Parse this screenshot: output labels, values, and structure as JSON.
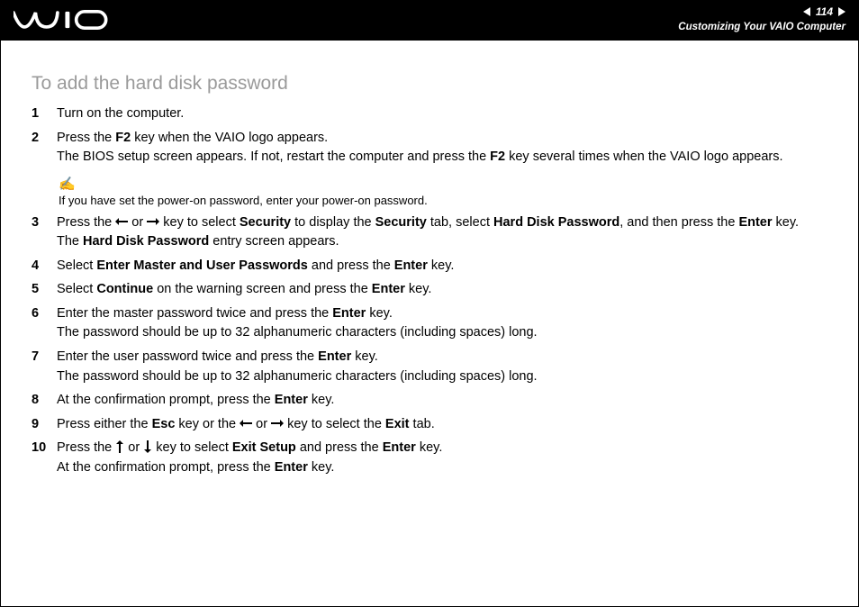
{
  "header": {
    "page_number": "114",
    "section_title": "Customizing Your VAIO Computer"
  },
  "heading": "To add the hard disk password",
  "note": "If you have set the power-on password, enter your power-on password.",
  "steps": {
    "s1": {
      "num": "1",
      "t1": "Turn on the computer."
    },
    "s2": {
      "num": "2",
      "p1a": "Press the ",
      "p1b": "F2",
      "p1c": " key when the VAIO logo appears.",
      "p2a": "The BIOS setup screen appears. If not, restart the computer and press the ",
      "p2b": "F2",
      "p2c": " key several times when the VAIO logo appears."
    },
    "s3": {
      "num": "3",
      "p1a": "Press the ",
      "p1b": " or ",
      "p1c": " key to select ",
      "p1d": "Security",
      "p1e": " to display the ",
      "p1f": "Security",
      "p1g": " tab, select ",
      "p1h": "Hard Disk Password",
      "p1i": ", and then press the ",
      "p1j": "Enter",
      "p1k": " key.",
      "p2a": "The ",
      "p2b": "Hard Disk Password",
      "p2c": " entry screen appears."
    },
    "s4": {
      "num": "4",
      "p1a": "Select ",
      "p1b": "Enter Master and User Passwords",
      "p1c": " and press the ",
      "p1d": "Enter",
      "p1e": " key."
    },
    "s5": {
      "num": "5",
      "p1a": "Select ",
      "p1b": "Continue",
      "p1c": " on the warning screen and press the ",
      "p1d": "Enter",
      "p1e": " key."
    },
    "s6": {
      "num": "6",
      "p1a": "Enter the master password twice and press the ",
      "p1b": "Enter",
      "p1c": " key.",
      "p2": "The password should be up to 32 alphanumeric characters (including spaces) long."
    },
    "s7": {
      "num": "7",
      "p1a": "Enter the user password twice and press the ",
      "p1b": "Enter",
      "p1c": " key.",
      "p2": "The password should be up to 32 alphanumeric characters (including spaces) long."
    },
    "s8": {
      "num": "8",
      "p1a": "At the confirmation prompt, press the ",
      "p1b": "Enter",
      "p1c": " key."
    },
    "s9": {
      "num": "9",
      "p1a": "Press either the ",
      "p1b": "Esc",
      "p1c": " key or the ",
      "p1d": " or ",
      "p1e": " key to select the ",
      "p1f": "Exit",
      "p1g": " tab."
    },
    "s10": {
      "num": "10",
      "p1a": "Press the ",
      "p1b": " or ",
      "p1c": " key to select ",
      "p1d": "Exit Setup",
      "p1e": " and press the ",
      "p1f": "Enter",
      "p1g": " key.",
      "p2a": "At the confirmation prompt, press the ",
      "p2b": "Enter",
      "p2c": " key."
    }
  }
}
